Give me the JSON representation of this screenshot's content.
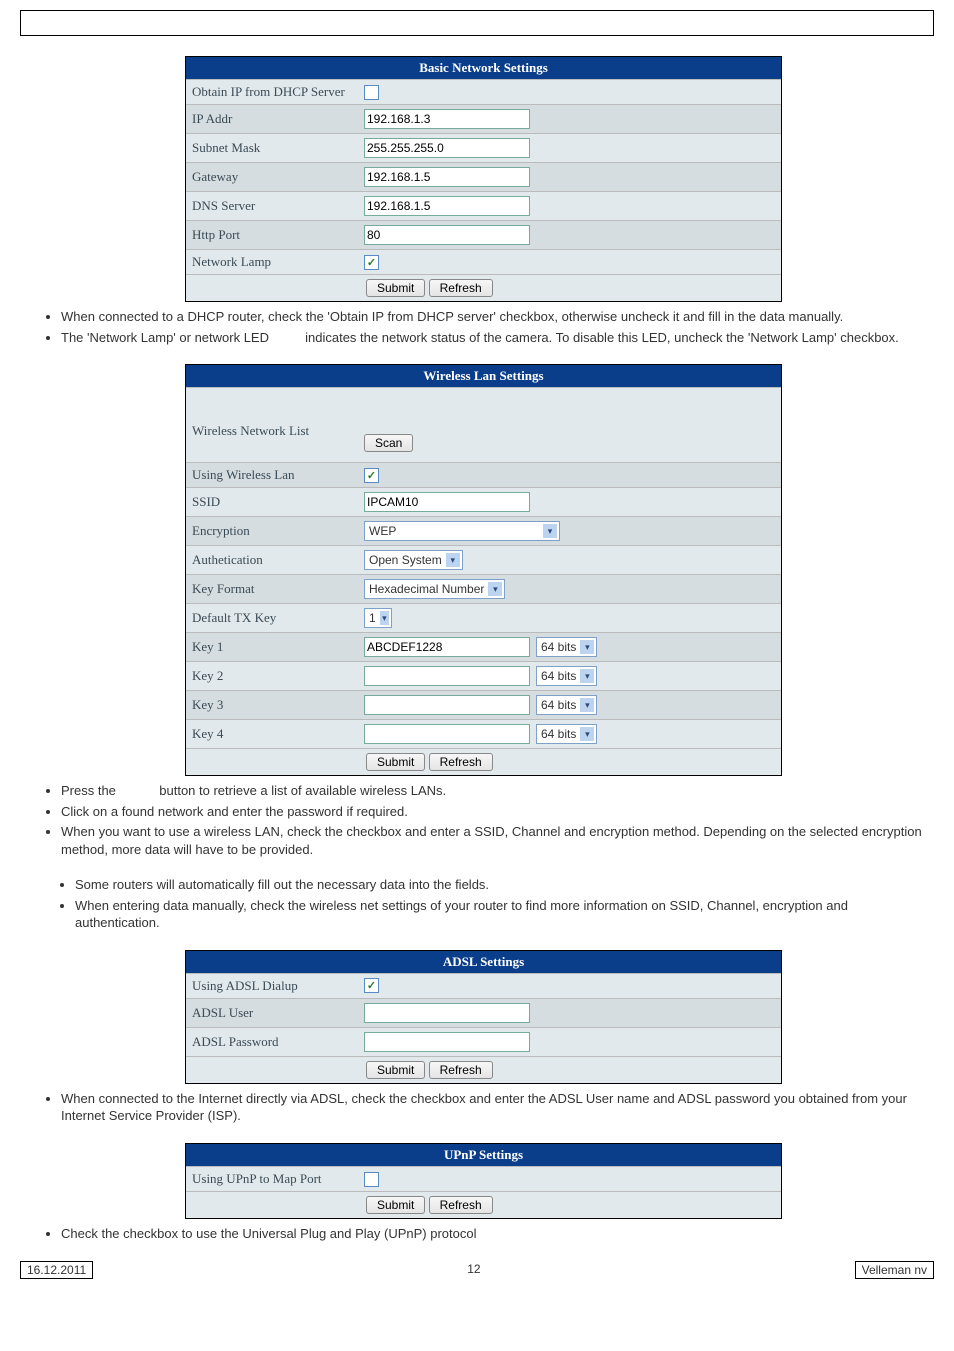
{
  "basic_network": {
    "title": "Basic Network Settings",
    "rows": {
      "obtain_ip": "Obtain IP from DHCP Server",
      "ip_addr_label": "IP Addr",
      "ip_addr_value": "192.168.1.3",
      "subnet_label": "Subnet Mask",
      "subnet_value": "255.255.255.0",
      "gateway_label": "Gateway",
      "gateway_value": "192.168.1.5",
      "dns_label": "DNS Server",
      "dns_value": "192.168.1.5",
      "http_port_label": "Http Port",
      "http_port_value": "80",
      "network_lamp_label": "Network Lamp"
    },
    "submit": "Submit",
    "refresh": "Refresh"
  },
  "body1": {
    "li1": "When connected to a DHCP router, check the 'Obtain IP from DHCP server' checkbox, otherwise uncheck it and fill in the data manually.",
    "li2a": "The 'Network Lamp' or network LED ",
    "li2b": " indicates the network status of the camera. To disable this LED, uncheck the 'Network Lamp' checkbox."
  },
  "wireless": {
    "title": "Wireless Lan Settings",
    "labels": {
      "list": "Wireless Network List",
      "scan": "Scan",
      "using": "Using Wireless Lan",
      "ssid": "SSID",
      "encryption": "Encryption",
      "auth": "Authetication",
      "keyformat": "Key Format",
      "default_tx": "Default TX Key",
      "key1": "Key 1",
      "key2": "Key 2",
      "key3": "Key 3",
      "key4": "Key 4"
    },
    "values": {
      "ssid": "IPCAM10",
      "encryption": "WEP",
      "auth": "Open System",
      "keyformat": "Hexadecimal Number",
      "default_tx": "1",
      "key1": "ABCDEF1228",
      "bits": "64 bits"
    },
    "submit": "Submit",
    "refresh": "Refresh"
  },
  "body2": {
    "li1a": "Press the ",
    "li1b": " button to retrieve a list of available wireless LANs.",
    "li2": "Click on a found network and enter the password if required.",
    "li3": "When you want to use a wireless LAN, check the checkbox and enter a SSID, Channel and encryption method. Depending on the selected encryption method, more data will have to be provided.",
    "sub1": "Some routers will automatically fill out the necessary data into the fields.",
    "sub2": "When entering data manually, check the wireless net settings of your router to find more information on SSID, Channel, encryption and authentication."
  },
  "adsl": {
    "title": "ADSL Settings",
    "labels": {
      "using": "Using ADSL Dialup",
      "user": "ADSL User",
      "password": "ADSL Password"
    },
    "submit": "Submit",
    "refresh": "Refresh"
  },
  "body3": {
    "li1": "When connected to the Internet directly via ADSL, check the checkbox and enter the ADSL User name and ADSL password you obtained from your Internet Service Provider (ISP)."
  },
  "upnp": {
    "title": "UPnP Settings",
    "labels": {
      "using": "Using UPnP to Map Port"
    },
    "submit": "Submit",
    "refresh": "Refresh"
  },
  "body4": {
    "li1": "Check the checkbox to use the Universal Plug and Play (UPnP) protocol"
  },
  "footer": {
    "date": "16.12.2011",
    "page": "12",
    "brand": "Velleman nv"
  }
}
